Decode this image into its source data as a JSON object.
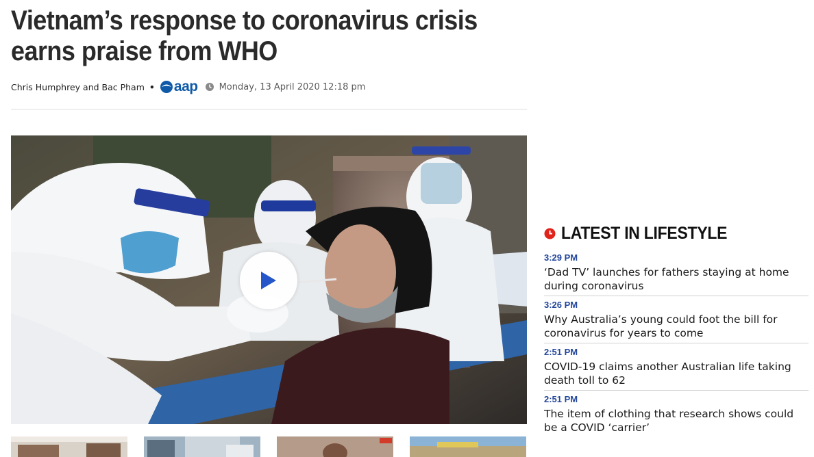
{
  "article": {
    "headline": "Vietnam’s response to coronavirus crisis earns praise from WHO",
    "authors": "Chris Humphrey and Bac Pham",
    "separator": "•",
    "source_logo": "aap",
    "date": "Monday, 13 April 2020 12:18 pm"
  },
  "icons": {
    "source": "aap-logo-icon",
    "date": "clock-icon",
    "video": "play-icon",
    "latest": "clock-icon"
  },
  "colors": {
    "headline": "#2a2a2a",
    "aap_blue": "#0f5aa8",
    "time_blue": "#24479c",
    "latest_red": "#e0231b",
    "play_blue": "#2456c9"
  },
  "latest": {
    "title": "LATEST IN LIFESTYLE",
    "items": [
      {
        "time": "3:29 PM",
        "title": "‘Dad TV’ launches for fathers staying at home during coronavirus"
      },
      {
        "time": "3:26 PM",
        "title": "Why Australia’s young could foot the bill for coronavirus for years to come"
      },
      {
        "time": "2:51 PM",
        "title": "COVID-19 claims another Australian life taking death toll to 62"
      },
      {
        "time": "2:51 PM",
        "title": "The item of clothing that research shows could be a COVID ‘carrier’"
      }
    ]
  }
}
